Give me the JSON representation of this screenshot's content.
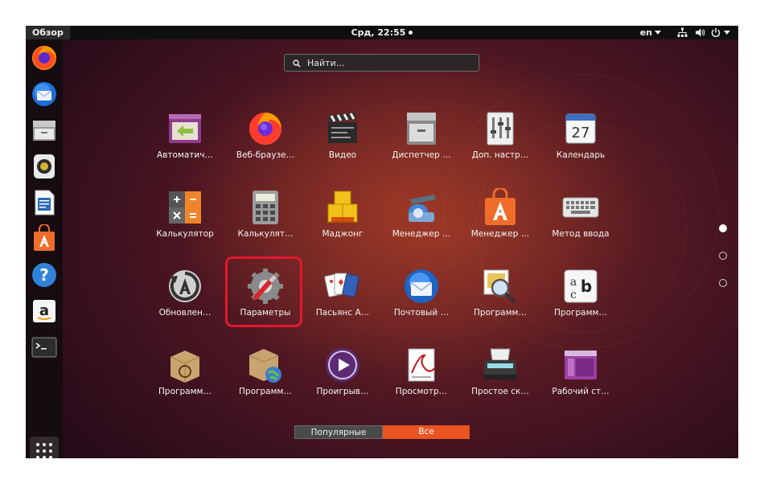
{
  "topbar": {
    "activities_label": "Обзор",
    "clock": "Срд, 22:55",
    "language": "en"
  },
  "dock": {
    "items": [
      "firefox-icon",
      "thunderbird-icon",
      "files-icon",
      "rhythmbox-icon",
      "writer-icon",
      "software-icon",
      "help-icon",
      "amazon-icon",
      "terminal-icon"
    ],
    "show_apps": "show-apps-icon"
  },
  "search": {
    "placeholder": "Найти…"
  },
  "apps": [
    {
      "label": "Автоматич…",
      "icon": "startup-apps-icon"
    },
    {
      "label": "Веб-браузе…",
      "icon": "firefox-icon"
    },
    {
      "label": "Видео",
      "icon": "video-clapper-icon"
    },
    {
      "label": "Диспетчер …",
      "icon": "file-cabinet-icon"
    },
    {
      "label": "Доп. настр…",
      "icon": "tweaks-icon"
    },
    {
      "label": "Календарь",
      "icon": "calendar-icon",
      "date": "27"
    },
    {
      "label": "Калькулятор",
      "icon": "calculator-icon"
    },
    {
      "label": "Калькулят…",
      "icon": "calculator-classic-icon"
    },
    {
      "label": "Маджонг",
      "icon": "mahjongg-icon"
    },
    {
      "label": "Менеджер …",
      "icon": "power-manager-icon"
    },
    {
      "label": "Менеджер …",
      "icon": "software-manager-icon"
    },
    {
      "label": "Метод ввода",
      "icon": "keyboard-icon"
    },
    {
      "label": "Обновлен…",
      "icon": "update-icon"
    },
    {
      "label": "Параметры",
      "icon": "settings-icon"
    },
    {
      "label": "Пасьянс А…",
      "icon": "playing-cards-icon"
    },
    {
      "label": "Почтовый …",
      "icon": "thunderbird-icon"
    },
    {
      "label": "Программ…",
      "icon": "image-magnifier-icon"
    },
    {
      "label": "Программ…",
      "icon": "font-viewer-icon"
    },
    {
      "label": "Программ…",
      "icon": "package-debian-icon"
    },
    {
      "label": "Программ…",
      "icon": "package-globe-icon"
    },
    {
      "label": "Проигрыв…",
      "icon": "media-player-icon"
    },
    {
      "label": "Просмотр…",
      "icon": "document-viewer-icon"
    },
    {
      "label": "Простое ск…",
      "icon": "scanner-icon"
    },
    {
      "label": "Рабочий ст…",
      "icon": "remote-desktop-icon"
    }
  ],
  "tabs": {
    "frequent": "Популярные",
    "all": "Все"
  },
  "pager": {
    "pages": 3,
    "active": 1
  },
  "colors": {
    "accent": "#e95420",
    "highlight": "#e3182d"
  }
}
